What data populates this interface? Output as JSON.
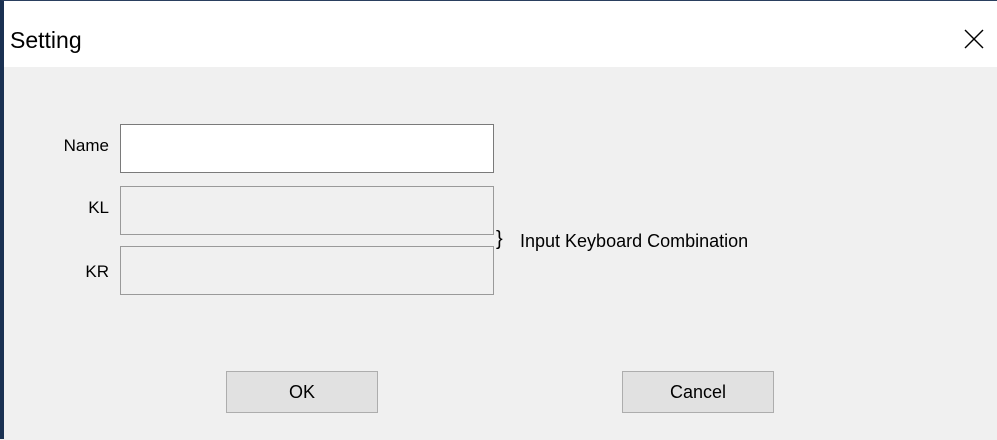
{
  "window": {
    "title": "Setting",
    "close_icon": "close-icon"
  },
  "form": {
    "name": {
      "label": "Name",
      "value": "",
      "enabled": true
    },
    "kl": {
      "label": "KL",
      "value": "",
      "enabled": false
    },
    "kr": {
      "label": "KR",
      "value": "",
      "enabled": false
    },
    "brace_glyph": "}",
    "hint": "Input Keyboard Combination"
  },
  "buttons": {
    "ok_label": "OK",
    "cancel_label": "Cancel"
  },
  "colors": {
    "window_border": "#1a3152",
    "dialog_background": "#f0f0f0",
    "button_face": "#e1e1e1"
  }
}
